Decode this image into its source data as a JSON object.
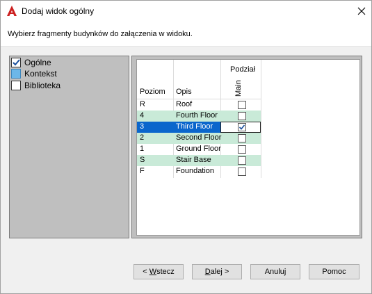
{
  "window": {
    "title": "Dodaj widok ogólny",
    "accent": "#cc2020"
  },
  "instruction": "Wybierz fragmenty budynków do załączenia w widoku.",
  "tree": [
    {
      "label": "Ogólne",
      "checked": true
    },
    {
      "label": "Kontekst",
      "checked": false
    },
    {
      "label": "Biblioteka",
      "checked": false
    }
  ],
  "grid": {
    "group_header": "Podział",
    "columns": {
      "level": "Poziom",
      "desc": "Opis",
      "main": "Main"
    },
    "rows": [
      {
        "level": "R",
        "desc": "Roof",
        "checked": false
      },
      {
        "level": "4",
        "desc": "Fourth Floor",
        "checked": false
      },
      {
        "level": "3",
        "desc": "Third Floor",
        "checked": true
      },
      {
        "level": "2",
        "desc": "Second Floor",
        "checked": false
      },
      {
        "level": "1",
        "desc": "Ground Floor",
        "checked": false
      },
      {
        "level": "S",
        "desc": "Stair Base",
        "checked": false
      },
      {
        "level": "F",
        "desc": "Foundation",
        "checked": false
      }
    ]
  },
  "buttons": {
    "back_pre": "< ",
    "back_key": "W",
    "back_rest": "stecz",
    "next_key": "D",
    "next_rest": "alej >",
    "cancel": "Anuluj",
    "help": "Pomoc"
  }
}
